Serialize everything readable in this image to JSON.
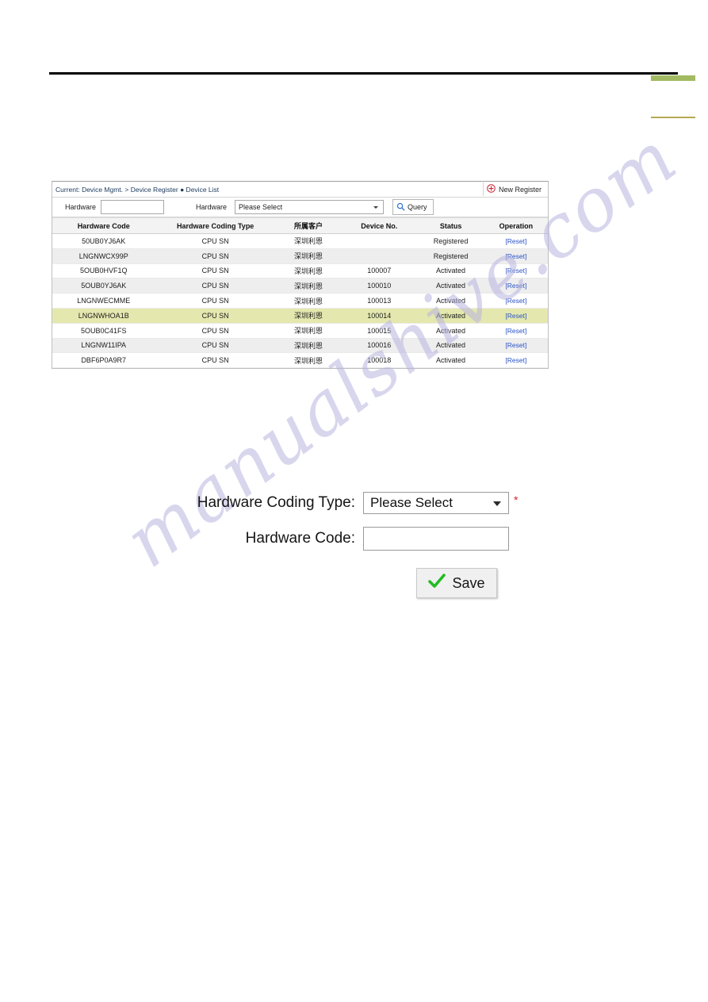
{
  "decorations": {
    "accent_green": "#a2bb62",
    "accent_olive": "#b4aa52",
    "rule_color": "#000000"
  },
  "watermark": {
    "text": "manualshive.com",
    "color": "#b9b5e0"
  },
  "list_panel": {
    "breadcrumb": "Current: Device Mgmt. > Device Register ● Device List",
    "new_register_label": "New Register",
    "new_register_icon": "plus-circle-icon",
    "accent_red": "#cc2233"
  },
  "filters": {
    "label_1": "Hardware",
    "input_value": "",
    "label_2": "Hardware",
    "select_value": "Please Select",
    "query_label": "Query",
    "query_icon": "search-icon",
    "query_icon_color": "#2a6fd4"
  },
  "table": {
    "columns": [
      "Hardware Code",
      "Hardware Coding Type",
      "所属客户",
      "Device No.",
      "Status",
      "Operation"
    ],
    "operation_label": "[Reset]",
    "highlight_color": "#e4e8ae",
    "rows": [
      {
        "code": "50UB0YJ6AK",
        "type": "CPU SN",
        "customer": "深圳利恩",
        "device_no": "",
        "status": "Registered",
        "operation": "[Reset]",
        "highlight": false
      },
      {
        "code": "LNGNWCX99P",
        "type": "CPU SN",
        "customer": "深圳利恩",
        "device_no": "",
        "status": "Registered",
        "operation": "[Reset]",
        "highlight": false
      },
      {
        "code": "5OUB0HVF1Q",
        "type": "CPU SN",
        "customer": "深圳利恩",
        "device_no": "100007",
        "status": "Activated",
        "operation": "[Reset]",
        "highlight": false
      },
      {
        "code": "5OUB0YJ6AK",
        "type": "CPU SN",
        "customer": "深圳利恩",
        "device_no": "100010",
        "status": "Activated",
        "operation": "[Reset]",
        "highlight": false
      },
      {
        "code": "LNGNWECMME",
        "type": "CPU SN",
        "customer": "深圳利恩",
        "device_no": "100013",
        "status": "Activated",
        "operation": "[Reset]",
        "highlight": false
      },
      {
        "code": "LNGNWHOA1B",
        "type": "CPU SN",
        "customer": "深圳利恩",
        "device_no": "100014",
        "status": "Activated",
        "operation": "[Reset]",
        "highlight": true
      },
      {
        "code": "5OUB0C41FS",
        "type": "CPU SN",
        "customer": "深圳利恩",
        "device_no": "100015",
        "status": "Activated",
        "operation": "[Reset]",
        "highlight": false
      },
      {
        "code": "LNGNW11IPA",
        "type": "CPU SN",
        "customer": "深圳利恩",
        "device_no": "100016",
        "status": "Activated",
        "operation": "[Reset]",
        "highlight": false
      },
      {
        "code": "DBF6P0A9R7",
        "type": "CPU SN",
        "customer": "深圳利恩",
        "device_no": "100018",
        "status": "Activated",
        "operation": "[Reset]",
        "highlight": false
      }
    ]
  },
  "form": {
    "coding_type_label": "Hardware Coding Type:",
    "coding_type_value": "Please Select",
    "required_marker": "*",
    "required_color": "#e02020",
    "hardware_code_label": "Hardware Code:",
    "hardware_code_value": "",
    "save_label": "Save",
    "save_icon": "check-icon",
    "save_icon_color": "#22bb22"
  }
}
